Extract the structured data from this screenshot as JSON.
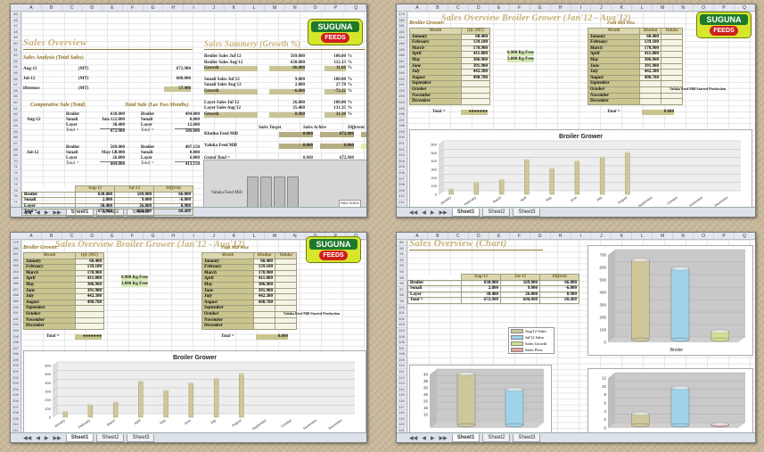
{
  "windows": [
    {
      "id": "w1",
      "title": "Sales Overview",
      "title2": "Sales Summery (Growth %)",
      "rows": [
        "45",
        "46",
        "47",
        "48",
        "49",
        "50",
        "51",
        "52",
        "53",
        "54",
        "55",
        "56",
        "57",
        "58",
        "59",
        "60",
        "61",
        "62",
        "63",
        "64",
        "65",
        "66",
        "67",
        "68",
        "69",
        "70",
        "71",
        "72",
        "73",
        "74",
        "75",
        "76",
        "77",
        "78"
      ]
    },
    {
      "id": "w2",
      "title": "Sales Overview Broiler Grower (Jan'12 - Aug'12)",
      "rows": [
        "179",
        "180",
        "181",
        "182",
        "183",
        "184",
        "185",
        "186",
        "187",
        "188",
        "189",
        "190",
        "191",
        "192",
        "193",
        "194",
        "195",
        "196",
        "197",
        "198",
        "199",
        "200",
        "201",
        "202",
        "203",
        "204",
        "205",
        "206",
        "207",
        "208",
        "209",
        "210",
        "211",
        "212"
      ]
    },
    {
      "id": "w3",
      "title": "Sales Overview Broiler Grower (Jan'12 - Aug'12)",
      "rows": [
        "179",
        "180",
        "181",
        "182",
        "183",
        "184",
        "185",
        "186",
        "187",
        "188",
        "189",
        "190",
        "191",
        "192",
        "193",
        "194",
        "195",
        "196",
        "197",
        "198",
        "199",
        "200",
        "201",
        "202",
        "203",
        "204",
        "205",
        "206",
        "207",
        "208",
        "209",
        "210",
        "211",
        "212"
      ]
    },
    {
      "id": "w4",
      "title": "Sales Overview (Chart)",
      "rows": [
        "89",
        "90",
        "91",
        "92",
        "93",
        "94",
        "95",
        "96",
        "97",
        "98",
        "99",
        "100",
        "101",
        "102",
        "103",
        "104",
        "105",
        "106",
        "107",
        "108",
        "109",
        "110",
        "111",
        "112",
        "113",
        "114",
        "115",
        "116",
        "117",
        "118",
        "119",
        "120",
        "121",
        "122",
        "123"
      ]
    }
  ],
  "columns": [
    "A",
    "B",
    "C",
    "D",
    "E",
    "F",
    "G",
    "H",
    "I",
    "J",
    "K",
    "L",
    "M",
    "N",
    "O",
    "P",
    "Q"
  ],
  "tabs": [
    "Sheet1",
    "Sheet2",
    "Sheet3"
  ],
  "logo": {
    "top": "SUGUNA",
    "bottom": "FEEDS"
  },
  "sales_analysis": {
    "label": "Sales Analysis (Total Sales)",
    "rows": [
      {
        "period": "Aug-12",
        "unit": "(MT)",
        "value": "672.980"
      },
      {
        "period": "Jul-12",
        "unit": "(MT)",
        "value": "608.000"
      },
      {
        "period": "ifference",
        "unit": "(MT)",
        "value": "57.980"
      }
    ]
  },
  "comparative": {
    "label": "Comparative Sale (Total)",
    "label2": "Total Sale (Las Two Months)",
    "aug": {
      "period": "Aug-12",
      "items": [
        [
          "Broiler",
          "638.000"
        ],
        [
          "Sonali",
          "2.800"
        ],
        [
          "Layer",
          "38.480"
        ]
      ],
      "total": "672.980"
    },
    "jun": {
      "period": "Jun-12",
      "items": [
        [
          "Broiler",
          "494.000"
        ],
        [
          "Sonali",
          "0.000"
        ],
        [
          "Layer",
          "12.600"
        ]
      ],
      "total": "506.600"
    },
    "jul": {
      "period": "Jul-12",
      "items": [
        [
          "Broiler",
          "569.000"
        ],
        [
          "Sonali",
          "9.000"
        ],
        [
          "Layer",
          "26.800"
        ]
      ],
      "total": "604.800"
    },
    "may": {
      "period": "May-12",
      "items": [
        [
          "Broiler",
          "407.150"
        ],
        [
          "Sonali",
          "0.000"
        ],
        [
          "Layer",
          "6.000"
        ]
      ],
      "total": "413.150"
    },
    "total_label": "Total ="
  },
  "summary": {
    "rows": [
      [
        "Broiler Sales Jul'12",
        "569.000",
        "100.00",
        "%"
      ],
      [
        "Broiler Sales Aug'12",
        "638.000",
        "112.13",
        "%"
      ],
      [
        "Growth",
        "66.000",
        "11.60",
        "%"
      ],
      [
        "Sonali Sales Jul'12",
        "9.000",
        "100.00",
        "%"
      ],
      [
        "Sonali Sales Aug'12",
        "2.800",
        "27.78",
        "%"
      ],
      [
        "Growth",
        "-6.800",
        "-72.22",
        "%"
      ],
      [
        "Layer Sales Jul'12",
        "26.800",
        "100.00",
        "%"
      ],
      [
        "Layer Sales Aug'12",
        "35.480",
        "131.35",
        "%"
      ],
      [
        "Growth",
        "8.980",
        "31.30",
        "%"
      ]
    ],
    "target_header": [
      "Sales Target",
      "Sales Achive",
      "Different"
    ],
    "khulna": [
      "Khulna Feed Mill",
      "0.000",
      "672.980",
      "-672.980"
    ],
    "valuka": [
      "Valuka Feed Mill",
      "0.000",
      "0.000",
      "0.000"
    ],
    "grand": [
      "Grand Total =",
      "0.000",
      "672.980",
      "-672.980"
    ]
  },
  "diff_table": {
    "header": [
      "",
      "Aug-12",
      "Jul-12",
      "Differnt"
    ],
    "rows": [
      [
        "Broiler",
        "638.000",
        "569.000",
        "66.000"
      ],
      [
        "Sonali",
        "2.800",
        "9.000",
        "-6.800"
      ],
      [
        "Layer",
        "38.480",
        "26.800",
        "8.980"
      ],
      [
        "Total =",
        "672.980",
        "604.800",
        "68.480"
      ]
    ]
  },
  "bar3d": {
    "label": "Valuka Feed Mill",
    "legend": [
      "Sales Achive",
      "Sales Target"
    ]
  },
  "broiler": {
    "label": "Broiler Grower:",
    "header": [
      "Month",
      "Qty (MT)"
    ],
    "months": [
      "January",
      "February",
      "March",
      "April",
      "May",
      "June",
      "July",
      "August",
      "September",
      "October",
      "November",
      "December"
    ],
    "qty": [
      "60.400",
      "139.180",
      "170.900",
      "411.880",
      "306.960",
      "391.980",
      "442.380",
      "498.780",
      "",
      "",
      "",
      ""
    ],
    "total_label": "Total =",
    "total": "●●●●●●●",
    "notes": [
      "0.900 Kg Free",
      "3.000 Kg Free"
    ],
    "mill_label": "Feed Mill Wise",
    "mill_header": [
      "Month",
      "Khulna",
      "Valuka"
    ],
    "mill_total": "0.000",
    "note_right": "Valuka Feed Mill Started Production"
  },
  "chart_data": [
    {
      "type": "bar",
      "title": "Broiler Grower",
      "categories": [
        "January",
        "February",
        "March",
        "April",
        "May",
        "June",
        "July",
        "August",
        "September",
        "October",
        "November",
        "December"
      ],
      "values": [
        60.4,
        139.18,
        170.9,
        411.88,
        306.96,
        391.98,
        442.38,
        498.78,
        0,
        0,
        0,
        0
      ],
      "ylim": [
        0,
        600
      ],
      "yticks": [
        0,
        100,
        200,
        300,
        400,
        500,
        600
      ]
    },
    {
      "type": "bar",
      "title": "",
      "categories": [
        "Broiler"
      ],
      "series": [
        {
          "name": "Aug'12 Sales",
          "values": [
            638
          ]
        },
        {
          "name": "Jul'12 Sales",
          "values": [
            569
          ]
        },
        {
          "name": "Sales Growth",
          "values": [
            66
          ]
        }
      ],
      "ylim": [
        0,
        700
      ],
      "yticks": [
        0,
        100,
        200,
        300,
        400,
        500,
        600,
        700
      ],
      "xlabel": "Broiler"
    },
    {
      "type": "bar",
      "title": "",
      "categories": [
        "Layer"
      ],
      "series": [
        {
          "name": "Aug'12 Sales",
          "values": [
            38.48
          ]
        },
        {
          "name": "Jul'12 Sales",
          "values": [
            26.8
          ]
        }
      ],
      "ylim": [
        0,
        40
      ],
      "yticks": [
        10,
        15,
        20,
        25,
        30,
        35,
        40
      ]
    },
    {
      "type": "bar",
      "title": "",
      "categories": [
        "Sonali"
      ],
      "series": [
        {
          "name": "Aug'12 Sales",
          "values": [
            2.8
          ]
        },
        {
          "name": "Jul'12 Sales",
          "values": [
            9
          ]
        },
        {
          "name": "Sales Flow",
          "values": [
            -0.2
          ]
        }
      ],
      "ylim": [
        0,
        12
      ],
      "yticks": [
        0,
        2,
        4,
        6,
        8,
        10,
        12
      ]
    }
  ],
  "legend4": [
    "Aug'12 Sales",
    "Jul'12 Sales",
    "Sales Growth",
    "Sales Flow"
  ],
  "colors": {
    "bar": "#cfc69a",
    "barDark": "#9b9466",
    "blue": "#9fd3ea",
    "green": "#cfe18e",
    "pink": "#e7a0a0",
    "title": "#c8b27a"
  }
}
